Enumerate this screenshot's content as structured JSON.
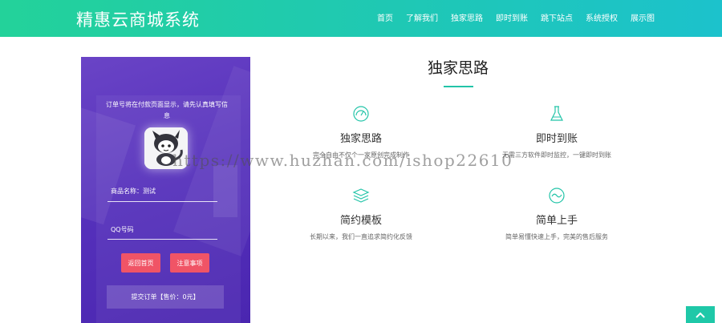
{
  "header": {
    "brand": "精惠云商城系统",
    "nav": [
      "首页",
      "了解我们",
      "独家思路",
      "即时到账",
      "跳下站点",
      "系统授权",
      "展示图"
    ]
  },
  "order_form": {
    "notice": "订单号将在付款页面显示，请先认真填写信息",
    "product_label": "商品名称：测试",
    "qq_placeholder": "QQ号码",
    "back_button": "返回首页",
    "notes_button": "注意事项",
    "submit_button": "提交订单【售价：0元】"
  },
  "section": {
    "title": "独家思路",
    "features": [
      {
        "title": "独家思路",
        "desc": "完全自由不仅个一家原创完成制作",
        "icon": "gauge-icon"
      },
      {
        "title": "即时到账",
        "desc": "无需三方软件即时监控，一键即时到账",
        "icon": "flask-icon"
      },
      {
        "title": "简约模板",
        "desc": "长期以来，我们一直追求简约化反馈",
        "icon": "layers-icon"
      },
      {
        "title": "简单上手",
        "desc": "简单易懂快速上手，完美的售后服务",
        "icon": "wave-icon"
      }
    ]
  },
  "watermark": "https://www.huzhan.com/ishop22610",
  "colors": {
    "accent": "#22c4a8",
    "purple": "#5a35bd",
    "red": "#f05466"
  }
}
